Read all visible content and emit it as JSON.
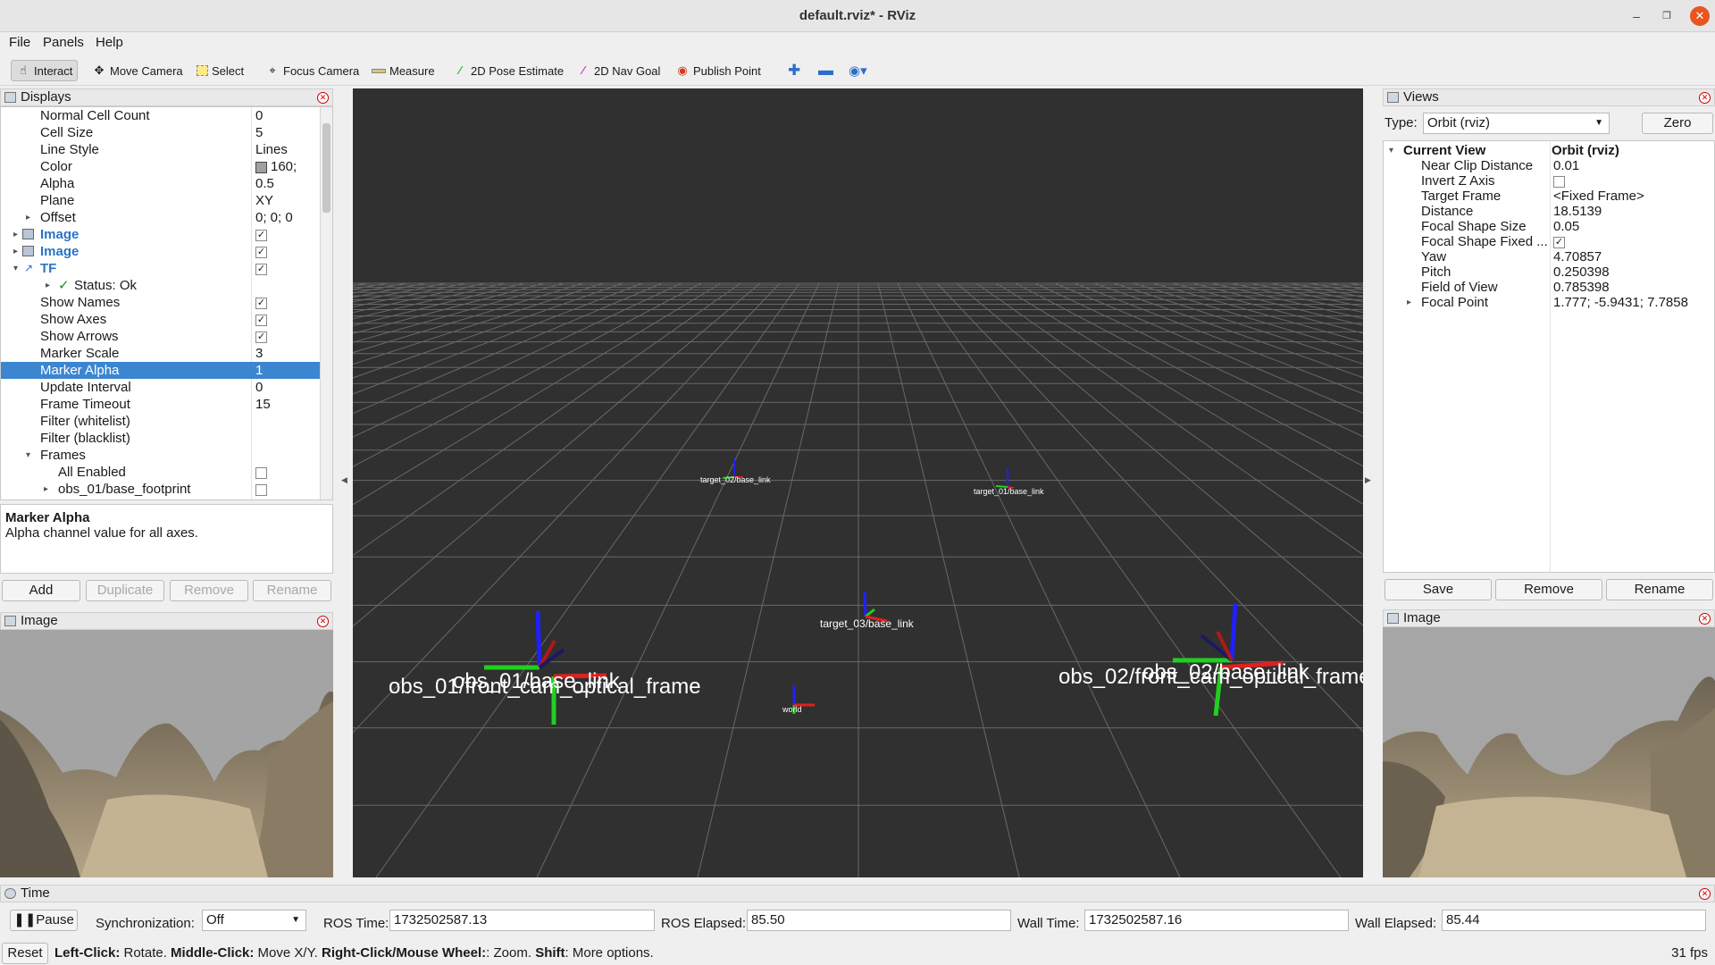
{
  "window": {
    "title": "default.rviz* - RViz"
  },
  "menu": [
    "File",
    "Panels",
    "Help"
  ],
  "toolbar": {
    "interact": "Interact",
    "move_camera": "Move Camera",
    "select": "Select",
    "focus_camera": "Focus Camera",
    "measure": "Measure",
    "pose_estimate": "2D Pose Estimate",
    "nav_goal": "2D Nav Goal",
    "publish_point": "Publish Point"
  },
  "displays": {
    "title": "Displays",
    "rows": [
      {
        "label": "Normal Cell Count",
        "value": "0"
      },
      {
        "label": "Cell Size",
        "value": "5"
      },
      {
        "label": "Line Style",
        "value": "Lines"
      },
      {
        "label": "Color",
        "value": "160;"
      },
      {
        "label": "Alpha",
        "value": "0.5"
      },
      {
        "label": "Plane",
        "value": "XY"
      },
      {
        "label": "Offset",
        "value": "0; 0; 0"
      },
      {
        "label": "Image",
        "value": ""
      },
      {
        "label": "Image",
        "value": ""
      },
      {
        "label": "TF",
        "value": ""
      },
      {
        "label": "Status: Ok",
        "value": ""
      },
      {
        "label": "Show Names",
        "value": ""
      },
      {
        "label": "Show Axes",
        "value": ""
      },
      {
        "label": "Show Arrows",
        "value": ""
      },
      {
        "label": "Marker Scale",
        "value": "3"
      },
      {
        "label": "Marker Alpha",
        "value": "1"
      },
      {
        "label": "Update Interval",
        "value": "0"
      },
      {
        "label": "Frame Timeout",
        "value": "15"
      },
      {
        "label": "Filter (whitelist)",
        "value": ""
      },
      {
        "label": "Filter (blacklist)",
        "value": ""
      },
      {
        "label": "Frames",
        "value": ""
      },
      {
        "label": "All Enabled",
        "value": ""
      },
      {
        "label": "obs_01/base_footprint",
        "value": ""
      }
    ],
    "description_title": "Marker Alpha",
    "description_text": "Alpha channel value for all axes.",
    "buttons": {
      "add": "Add",
      "duplicate": "Duplicate",
      "remove": "Remove",
      "rename": "Rename"
    }
  },
  "image_panel_left": {
    "title": "Image"
  },
  "image_panel_right": {
    "title": "Image"
  },
  "views": {
    "title": "Views",
    "type_label": "Type:",
    "type_value": "Orbit (rviz)",
    "zero": "Zero",
    "current_view_label": "Current View",
    "current_view_value": "Orbit (rviz)",
    "props": [
      {
        "label": "Near Clip Distance",
        "value": "0.01"
      },
      {
        "label": "Invert Z Axis",
        "value": ""
      },
      {
        "label": "Target Frame",
        "value": "<Fixed Frame>"
      },
      {
        "label": "Distance",
        "value": "18.5139"
      },
      {
        "label": "Focal Shape Size",
        "value": "0.05"
      },
      {
        "label": "Focal Shape Fixed ...",
        "value": ""
      },
      {
        "label": "Yaw",
        "value": "4.70857"
      },
      {
        "label": "Pitch",
        "value": "0.250398"
      },
      {
        "label": "Field of View",
        "value": "0.785398"
      },
      {
        "label": "Focal Point",
        "value": "1.777; -5.9431; 7.7858"
      }
    ],
    "buttons": {
      "save": "Save",
      "remove": "Remove",
      "rename": "Rename"
    }
  },
  "scene": {
    "frames": [
      {
        "name": "target_02/base_link"
      },
      {
        "name": "target_01/base_link"
      },
      {
        "name": "target_03/base_link"
      },
      {
        "name": "world"
      },
      {
        "name": "obs_01/base_link"
      },
      {
        "name": "obs_01/front_cam_optical_frame"
      },
      {
        "name": "obs_02/base_link"
      },
      {
        "name": "obs_02/front_cam_optical_frame"
      }
    ]
  },
  "time": {
    "title": "Time",
    "pause": "Pause",
    "sync_label": "Synchronization:",
    "sync_value": "Off",
    "ros_time_label": "ROS Time:",
    "ros_time": "1732502587.13",
    "ros_elapsed_label": "ROS Elapsed:",
    "ros_elapsed": "85.50",
    "wall_time_label": "Wall Time:",
    "wall_time": "1732502587.16",
    "wall_elapsed_label": "Wall Elapsed:",
    "wall_elapsed": "85.44"
  },
  "status": {
    "reset": "Reset",
    "k1": "Left-Click:",
    "t1": " Rotate. ",
    "k2": "Middle-Click:",
    "t2": " Move X/Y. ",
    "k3": "Right-Click/Mouse Wheel:",
    "t3": ": Zoom. ",
    "k4": "Shift",
    "t4": ": More options.",
    "fps": "31 fps"
  }
}
